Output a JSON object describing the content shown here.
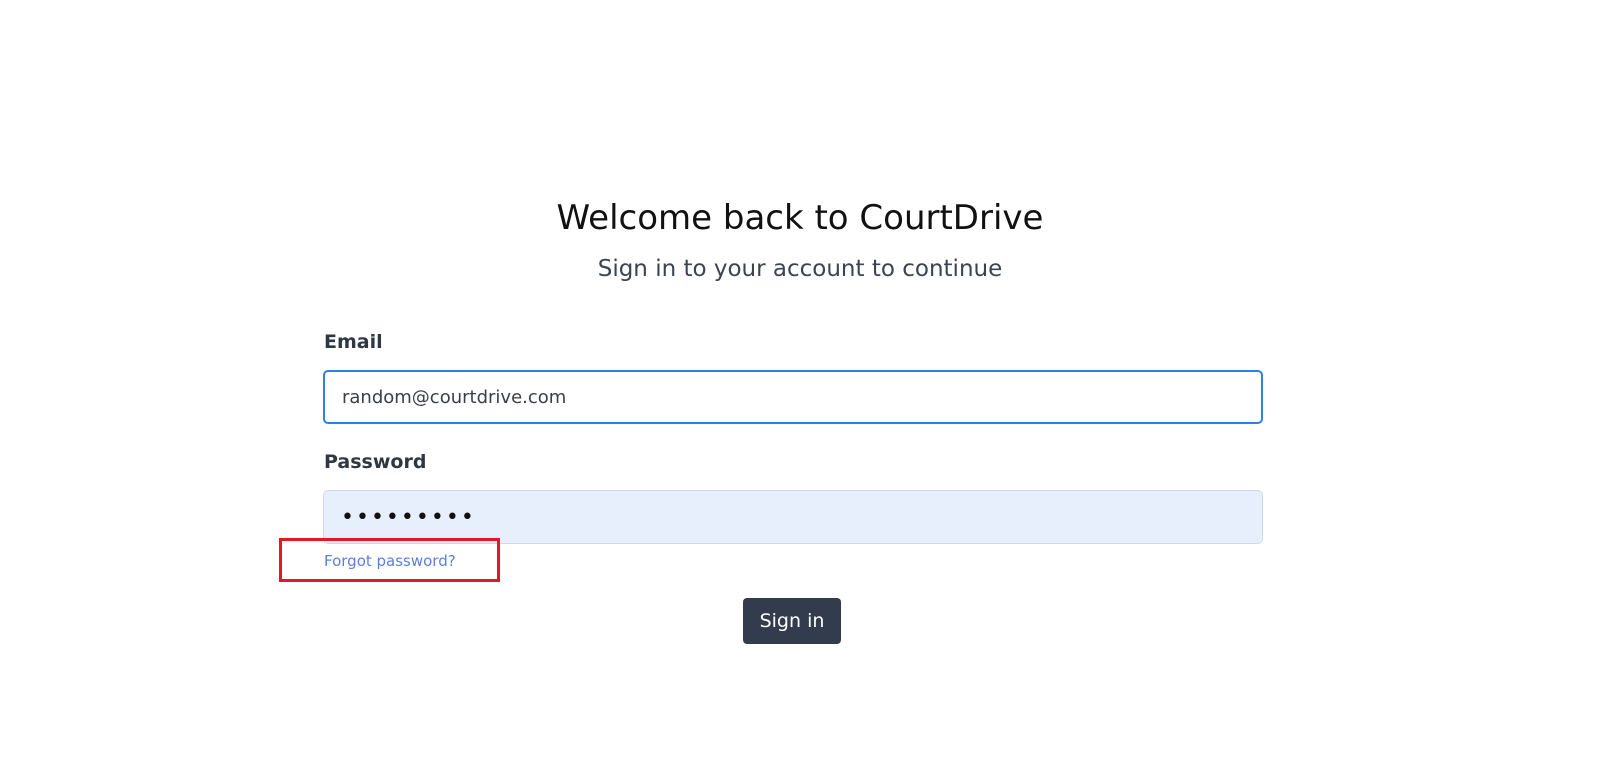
{
  "page": {
    "heading": "Welcome back to CourtDrive",
    "subheading": "Sign in to your account to continue"
  },
  "form": {
    "email_label": "Email",
    "email_value": "random@courtdrive.com",
    "password_label": "Password",
    "password_masked": "•••••••••",
    "forgot_link": "Forgot password?",
    "submit_label": "Sign in"
  },
  "annotation": {
    "highlight_color": "#e0182a",
    "highlighted_element": "forgot-password-link"
  },
  "colors": {
    "focus_border": "#2f80e6",
    "autofill_background": "#e8effc",
    "link": "#5a7fe0",
    "button_background": "#323c4d"
  }
}
